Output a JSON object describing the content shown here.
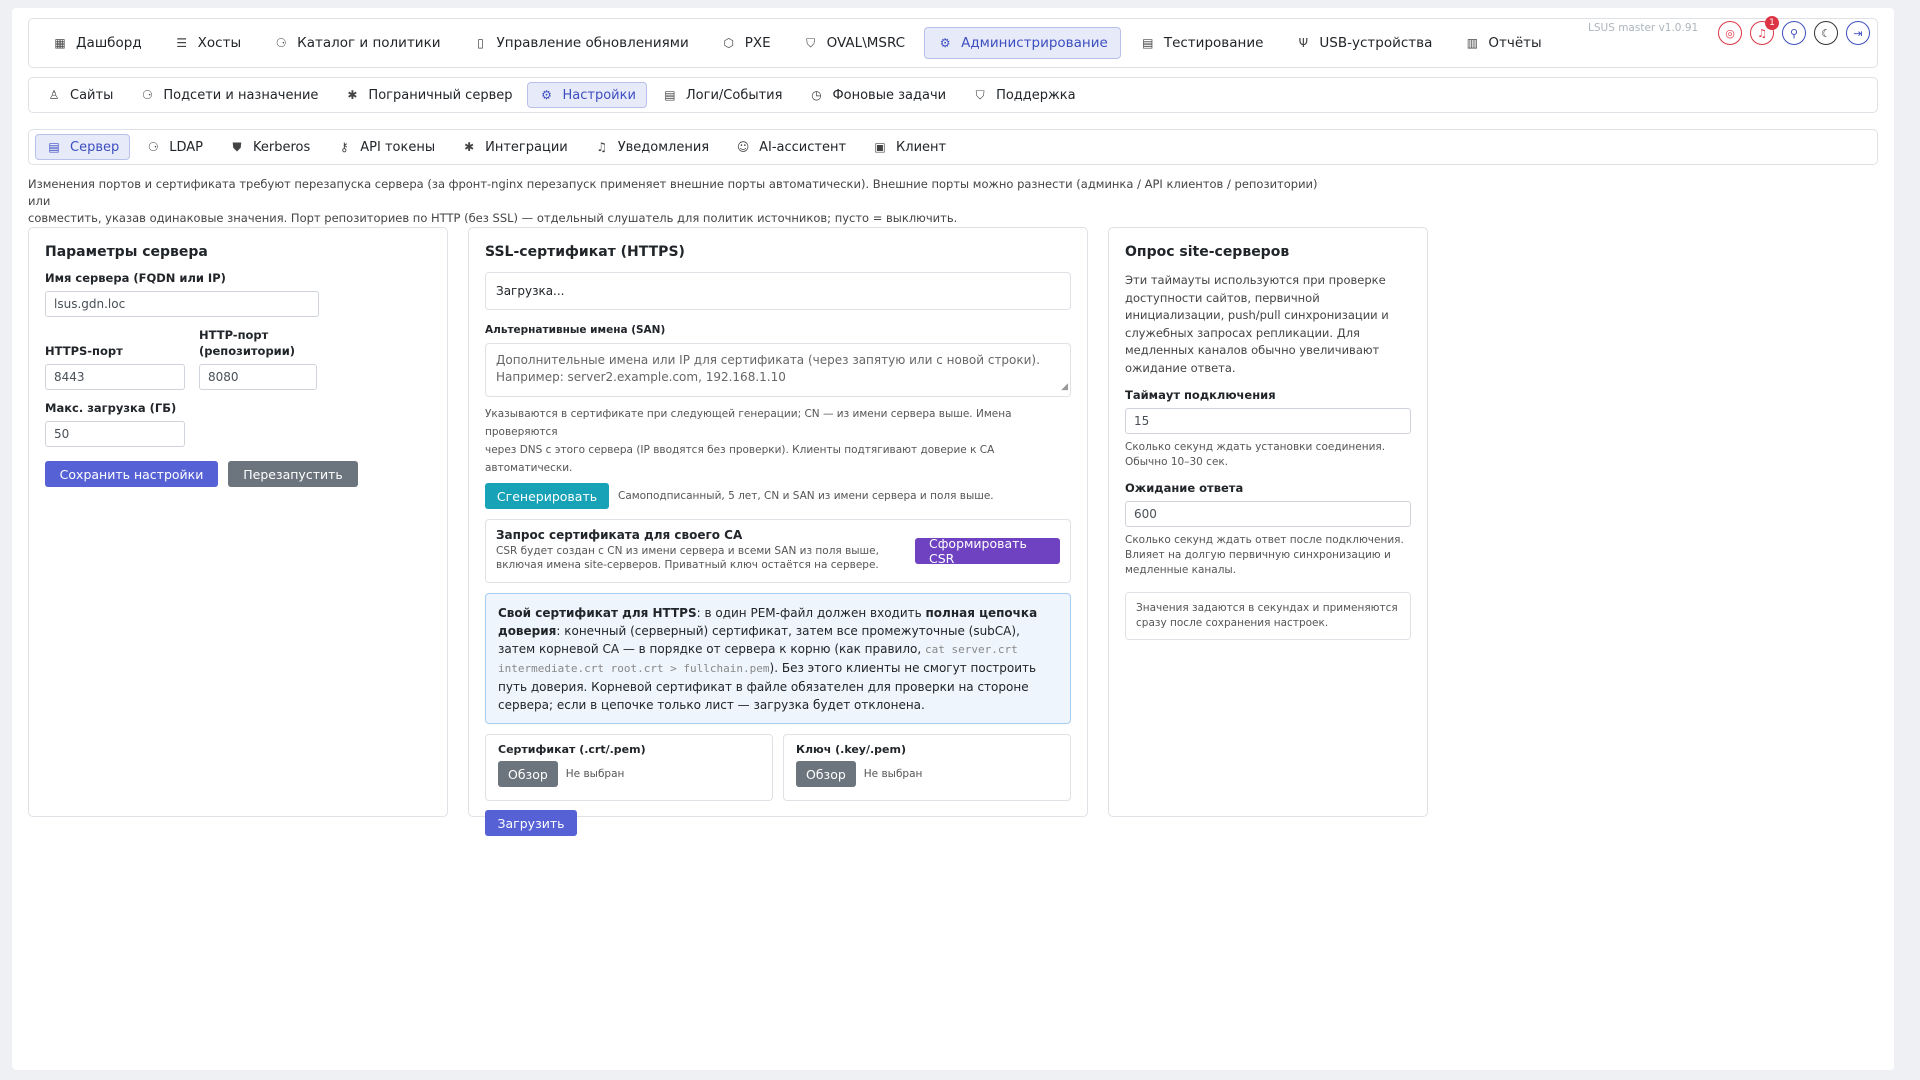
{
  "topnav": {
    "items": [
      {
        "label": "Дашборд",
        "icon": "dashboard-icon",
        "glyph": "▦"
      },
      {
        "label": "Хосты",
        "icon": "server-icon",
        "glyph": "☰"
      },
      {
        "label": "Каталог и политики",
        "icon": "diagram-icon",
        "glyph": "⚆"
      },
      {
        "label": "Управление обновлениями",
        "icon": "file-icon",
        "glyph": "▯"
      },
      {
        "label": "PXE",
        "icon": "box-icon",
        "glyph": "⬡"
      },
      {
        "label": "OVAL\\MSRC",
        "icon": "shield-check-icon",
        "glyph": "⛉"
      },
      {
        "label": "Администрирование",
        "icon": "admin-gear-icon",
        "glyph": "⚙"
      },
      {
        "label": "Тестирование",
        "icon": "clipboard-icon",
        "glyph": "▤"
      },
      {
        "label": "USB-устройства",
        "icon": "usb-icon",
        "glyph": "Ψ"
      },
      {
        "label": "Отчёты",
        "icon": "report-icon",
        "glyph": "▥"
      }
    ],
    "version": "LSUS master v1.0.91",
    "notification_count": "1"
  },
  "subnav": {
    "items": [
      {
        "label": "Сайты",
        "icon": "person-icon",
        "glyph": "♙"
      },
      {
        "label": "Подсети и назначение",
        "icon": "network-icon",
        "glyph": "⚆"
      },
      {
        "label": "Пограничный сервер",
        "icon": "hub-icon",
        "glyph": "✱"
      },
      {
        "label": "Настройки",
        "icon": "settings-icon",
        "glyph": "⚙"
      },
      {
        "label": "Логи/События",
        "icon": "log-icon",
        "glyph": "▤"
      },
      {
        "label": "Фоновые задачи",
        "icon": "clock-icon",
        "glyph": "◷"
      },
      {
        "label": "Поддержка",
        "icon": "support-shield-icon",
        "glyph": "⛉"
      }
    ]
  },
  "settings_tabs": {
    "items": [
      {
        "label": "Сервер",
        "icon": "server-icon",
        "glyph": "▤"
      },
      {
        "label": "LDAP",
        "icon": "ldap-icon",
        "glyph": "⚆"
      },
      {
        "label": "Kerberos",
        "icon": "kerberos-icon",
        "glyph": "⛊"
      },
      {
        "label": "API токены",
        "icon": "key-icon",
        "glyph": "⚷"
      },
      {
        "label": "Интеграции",
        "icon": "integration-icon",
        "glyph": "✱"
      },
      {
        "label": "Уведомления",
        "icon": "bell-icon",
        "glyph": "♫"
      },
      {
        "label": "AI-ассистент",
        "icon": "robot-icon",
        "glyph": "☺"
      },
      {
        "label": "Клиент",
        "icon": "client-icon",
        "glyph": "▣"
      }
    ]
  },
  "note": {
    "line1": "Изменения портов и сертификата требуют перезапуска сервера (за фронт-nginx перезапуск применяет внешние порты автоматически). Внешние порты можно разнести (админка / API клиентов / репозитории) или",
    "line2": "совместить, указав одинаковые значения. Порт репозиториев по HTTP (без SSL) — отдельный слушатель для политик источников; пусто = выключить."
  },
  "server_params": {
    "title": "Параметры сервера",
    "hostname_label": "Имя сервера (FQDN или IP)",
    "hostname_value": "lsus.gdn.loc",
    "https_label": "HTTPS-порт",
    "https_value": "8443",
    "http_label1": "HTTP-порт",
    "http_label2": "(репозитории)",
    "http_value": "8080",
    "max_upload_label": "Макс. загрузка (ГБ)",
    "max_upload_value": "50",
    "save_label": "Сохранить настройки",
    "restart_label": "Перезапустить"
  },
  "ssl": {
    "title": "SSL-сертификат (HTTPS)",
    "status": "Загрузка...",
    "san_label": "Альтернативные имена (SAN)",
    "san_placeholder1": "Дополнительные имена или IP для сертификата (через запятую или с новой строки).",
    "san_placeholder2": "Например: server2.example.com, 192.168.1.10",
    "san_hint1": "Указываются в сертификате при следующей генерации; CN — из имени сервера выше. Имена проверяются",
    "san_hint2": "через DNS с этого сервера (IP вводятся без проверки). Клиенты подтягивают доверие к CA автоматически.",
    "generate_label": "Сгенерировать",
    "generate_hint": "Самоподписанный, 5 лет, CN и SAN из имени сервера и поля выше.",
    "csr_title": "Запрос сертификата для своего CA",
    "csr_hint1": "CSR будет создан с CN из имени сервера и всеми SAN из поля выше,",
    "csr_hint2": "включая имена site-серверов. Приватный ключ остаётся на сервере.",
    "csr_button": "Сформировать CSR",
    "info_b1": "Свой сертификат для HTTPS",
    "info_t1": ": в один PEM-файл должен входить ",
    "info_b2": "полная цепочка доверия",
    "info_t2": ": конечный (серверный) сертификат, затем все промежуточные (subCA), затем корневой CA — в порядке от сервера к корню (как правило, ",
    "info_code": "cat server.crt intermediate.crt root.crt > fullchain.pem",
    "info_t3": "). Без этого клиенты не смогут построить путь доверия. Корневой сертификат в файле обязателен для проверки на стороне сервера; если в цепочке только лист — загрузка будет отклонена.",
    "cert_label": "Сертификат (.crt/.pem)",
    "key_label": "Ключ (.key/.pem)",
    "browse_label": "Обзор",
    "none_selected": "Не выбран",
    "upload_label": "Загрузить"
  },
  "poll": {
    "title": "Опрос site-серверов",
    "desc": "Эти таймауты используются при проверке доступности сайтов, первичной инициализации, push/pull синхронизации и служебных запросах репликации. Для медленных каналов обычно увеличивают ожидание ответа.",
    "connect_label": "Таймаут подключения",
    "connect_value": "15",
    "connect_hint": "Сколько секунд ждать установки соединения. Обычно 10–30 сек.",
    "response_label": "Ожидание ответа",
    "response_value": "600",
    "response_hint": "Сколько секунд ждать ответ после подключения. Влияет на долгую первичную синхронизацию и медленные каналы.",
    "footer_note": "Значения задаются в секундах и применяются сразу после сохранения настроек."
  }
}
